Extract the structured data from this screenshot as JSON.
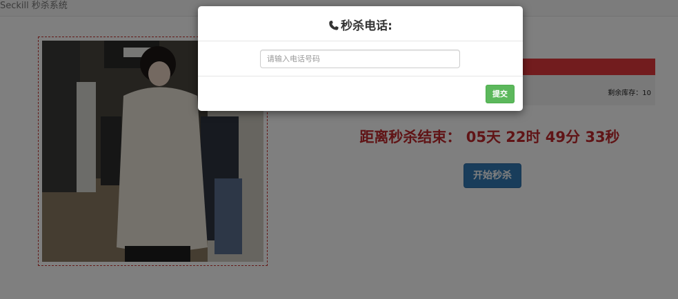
{
  "navbar": {
    "brand": "Seckill 秒杀系统"
  },
  "product": {
    "stock_text": "剩余库存：10",
    "countdown": "距离秒杀结束： 05天 22时 49分 33秒",
    "start_button": "开始秒杀"
  },
  "modal": {
    "title": "秒杀电话:",
    "phone_input": {
      "value": "",
      "placeholder": "请输入电话号码"
    },
    "submit_button": "提交"
  },
  "colors": {
    "countdown": "#c0282c",
    "start_button": "#337ab7",
    "submit_button": "#5cb85c",
    "frame_border": "#c9302c",
    "banner": "#e4393c"
  },
  "icons": {
    "modal_title_icon": "phone-icon"
  }
}
